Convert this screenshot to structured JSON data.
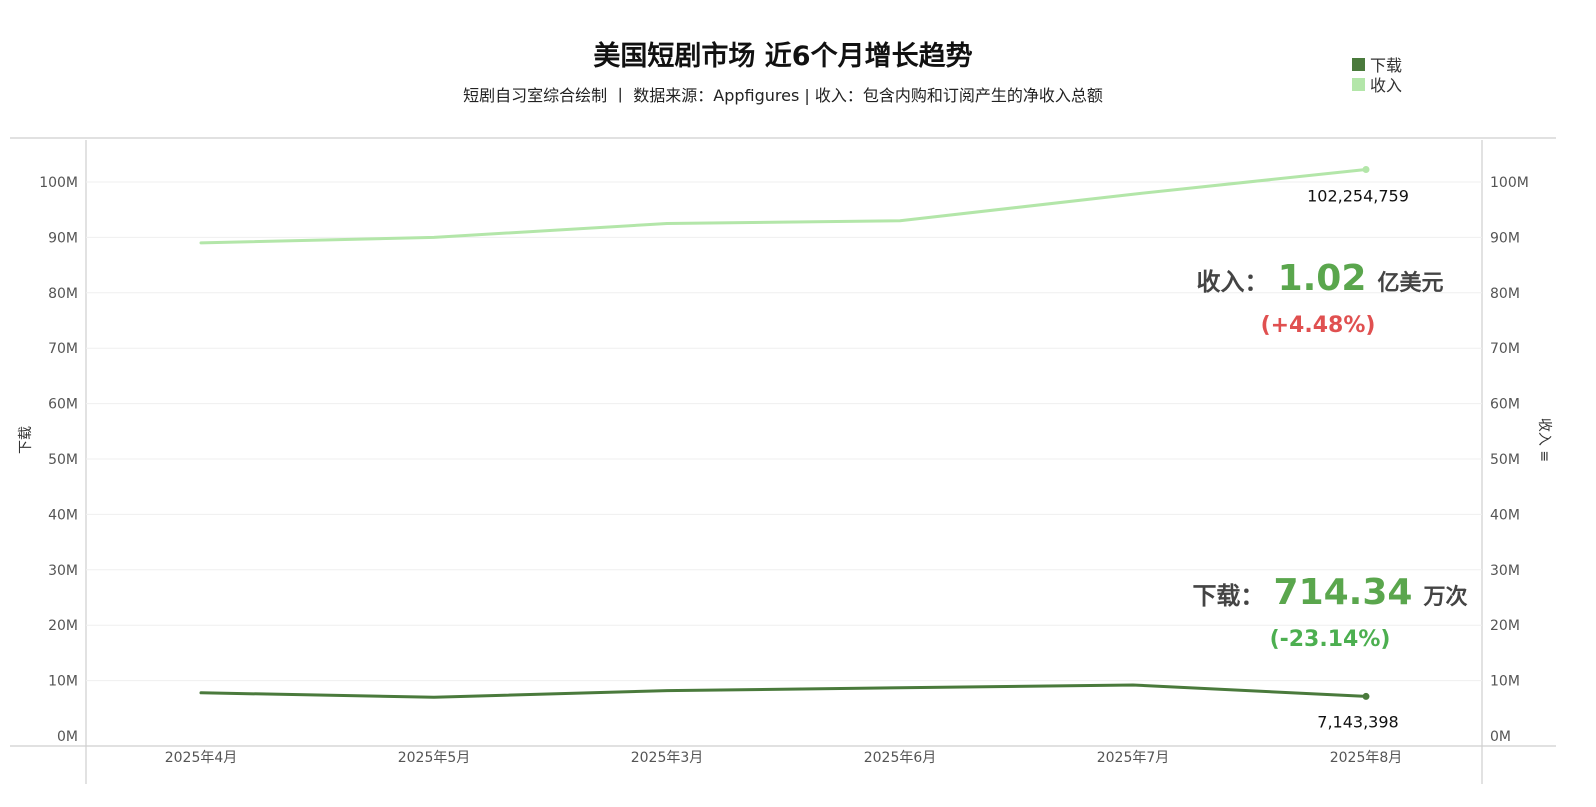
{
  "header": {
    "title": "美国短剧市场 近6个月增长趋势",
    "subtitle": "短剧自习室综合绘制 丨 数据来源：Appfigures | 收入：包含内购和订阅产生的净收入总额"
  },
  "legend": {
    "items": [
      {
        "label": "下载",
        "color": "#4a7a3c"
      },
      {
        "label": "收入",
        "color": "#b3e6a9"
      }
    ]
  },
  "axes": {
    "left_title": "下载",
    "right_title": "收入 ≡",
    "y_ticks": [
      "0M",
      "10M",
      "20M",
      "30M",
      "40M",
      "50M",
      "60M",
      "70M",
      "80M",
      "90M",
      "100M"
    ]
  },
  "annotations": {
    "revenue": {
      "label": "收入：",
      "value": "1.02",
      "unit": "亿美元",
      "change": "(+4.48%)",
      "change_color": "#e05050"
    },
    "downloads": {
      "label": "下载：",
      "value": "714.34",
      "unit": "万次",
      "change": "(-23.14%)",
      "change_color": "#4caf50"
    },
    "value_color": "#5aa64d",
    "label_color": "#444444"
  },
  "chart_data": {
    "type": "line",
    "categories": [
      "2025年4月",
      "2025年5月",
      "2025年3月",
      "2025年6月",
      "2025年7月",
      "2025年8月"
    ],
    "series": [
      {
        "name": "下载",
        "axis": "left",
        "color": "#4a7a3c",
        "values": [
          7800000,
          7000000,
          8200000,
          8700000,
          9200000,
          7143398
        ],
        "last_label": "7,143,398"
      },
      {
        "name": "收入",
        "axis": "right",
        "color": "#b3e6a9",
        "values": [
          89000000,
          90000000,
          92500000,
          93000000,
          97800000,
          102254759
        ],
        "last_label": "102,254,759"
      }
    ],
    "ylim": [
      0,
      105000000
    ],
    "grid": true,
    "legend_position": "top-right"
  }
}
